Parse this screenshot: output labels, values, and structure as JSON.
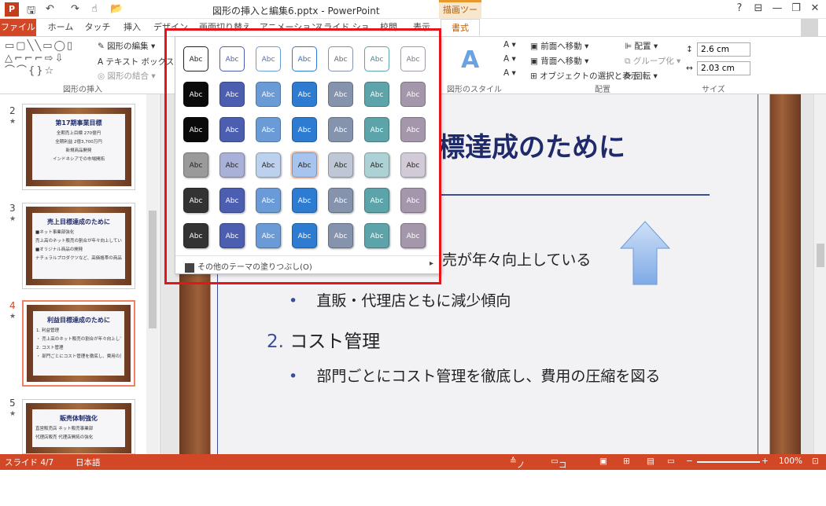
{
  "app": {
    "logo": "P",
    "title": "図形の挿入と編集6.pptx - PowerPoint",
    "context_tool": "描画ツール"
  },
  "window": {
    "help": "?",
    "ribbon_display": "⊟",
    "minimize": "—",
    "restore": "❐",
    "close": "✕"
  },
  "tabs": [
    "ファイル",
    "ホーム",
    "タッチ",
    "挿入",
    "デザイン",
    "画面切り替え",
    "アニメーション",
    "スライド ショー",
    "校閲",
    "表示",
    "書式"
  ],
  "ribbon": {
    "groups": {
      "insert_shapes": "図形の挿入",
      "shape_styles": "図形のスタイル",
      "arrange": "配置",
      "size": "サイズ"
    },
    "edit_shape": "図形の編集",
    "text_box": "テキスト ボックス",
    "merge_shapes": "図形の結合",
    "bring_forward": "前面へ移動",
    "send_backward": "背面へ移動",
    "selection_pane": "オブジェクトの選択と表示",
    "align": "配置",
    "group": "グループ化",
    "rotate": "回転",
    "height": "2.6 cm",
    "width": "2.03 cm"
  },
  "gallery": {
    "swatch_label": "Abc",
    "more_fills": "その他のテーマの塗りつぶし(O)",
    "rows": [
      {
        "colors": [
          "#ffffff",
          "#ffffff",
          "#ffffff",
          "#ffffff",
          "#ffffff",
          "#ffffff",
          "#ffffff"
        ],
        "borders": [
          "#222222",
          "#4b5eb0",
          "#6a9bd6",
          "#2e7bd2",
          "#8593ad",
          "#5ca4a9",
          "#a497ab"
        ],
        "text": [
          "#222",
          "#4b5eb0",
          "#4b72b0",
          "#2e6bbf",
          "#5a667d",
          "#3f8c90",
          "#7d6f85"
        ]
      },
      {
        "colors": [
          "#0a0a0a",
          "#4b5eb0",
          "#6a9bd6",
          "#2e7bd2",
          "#8593ad",
          "#5ca4a9",
          "#a497ab"
        ],
        "text": [
          "#fff",
          "#fff",
          "#fff",
          "#fff",
          "#fff",
          "#fff",
          "#fff"
        ]
      },
      {
        "colors": [
          "#0a0a0a",
          "#4b5eb0",
          "#6a9bd6",
          "#2e7bd2",
          "#8593ad",
          "#5ca4a9",
          "#a497ab"
        ],
        "text": [
          "#fff",
          "#fff",
          "#fff",
          "#fff",
          "#fff",
          "#fff",
          "#fff"
        ]
      },
      {
        "colors": [
          "#9a9a9a",
          "#a9b1d9",
          "#bcd1ee",
          "#a6c4ee",
          "#bfc7d6",
          "#acd2d5",
          "#d2cbd7"
        ],
        "text": [
          "#222",
          "#222",
          "#222",
          "#222",
          "#222",
          "#222",
          "#222"
        ]
      },
      {
        "colors": [
          "#333333",
          "#4b5eb0",
          "#6a9bd6",
          "#2e7bd2",
          "#8593ad",
          "#5ca4a9",
          "#a497ab"
        ],
        "text": [
          "#fff",
          "#fff",
          "#fff",
          "#fff",
          "#fff",
          "#fff",
          "#fff"
        ]
      },
      {
        "colors": [
          "#333333",
          "#4b5eb0",
          "#6a9bd6",
          "#2e7bd2",
          "#8593ad",
          "#5ca4a9",
          "#a497ab"
        ],
        "text": [
          "#fff",
          "#fff",
          "#fff",
          "#fff",
          "#fff",
          "#fff",
          "#fff"
        ]
      }
    ]
  },
  "slides": [
    {
      "num": "2",
      "star": "★",
      "title": "第17期事業目標",
      "lines": [
        "全期売上目標 270億円",
        "全期利益 2億3,700万円",
        "新規商品開発",
        "インドネシアでの市場開拓"
      ]
    },
    {
      "num": "3",
      "star": "★",
      "title": "売上目標達成のために",
      "lines": [
        "■ネット事業部強化",
        "   売上高のネット販売の割合が年々向上している",
        "■オリジナル商品の開発",
        "   ナチュラルプロダクツなど、高価格帯の商品を拡大"
      ]
    },
    {
      "num": "4",
      "star": "★",
      "title": "利益目標達成のために",
      "lines": [
        "1. 利益管理",
        "   ・ 売上高のネット販売の割合が年々向上している",
        "2. コスト管理",
        "   ・ 部門ごとにコスト管理を徹底し、費用の圧縮を図る"
      ]
    },
    {
      "num": "5",
      "star": "★",
      "title": "販売体制強化",
      "lines": [
        "直営販売店  ネット販売事業部",
        "代理店販売  代理店開拓の強化"
      ]
    }
  ],
  "slide": {
    "title": "標達成のために",
    "b1": "売が年々向上している",
    "b2_mark": "•",
    "b2": "直販・代理店ともに減少傾向",
    "n2": "2.",
    "n2_text": "コスト管理",
    "b3_mark": "•",
    "b3": "部門ごとにコスト管理を徹底し、費用の圧縮を図る"
  },
  "status": {
    "slide": "スライド 4/7",
    "lang": "日本語",
    "notes": "ノート",
    "comments": "コメント",
    "zoom": "100%"
  }
}
